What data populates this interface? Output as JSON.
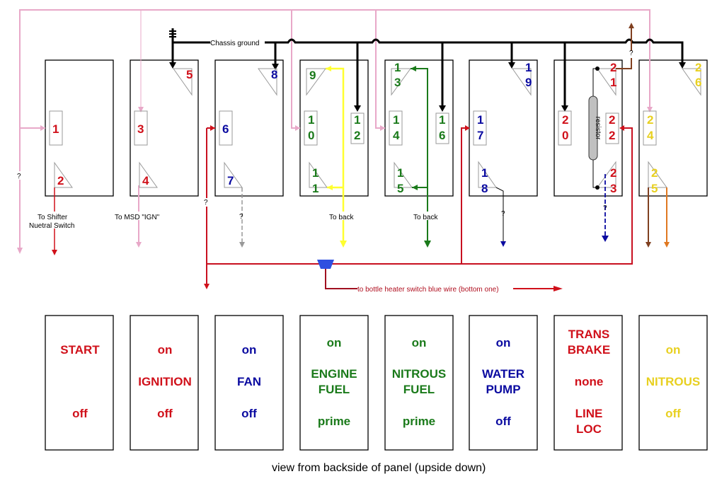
{
  "title": "view from backside of panel (upside down)",
  "colors": {
    "red": "#d0101a",
    "darkred": "#b01020",
    "blue": "#0a0aa0",
    "green": "#1a7a1a",
    "yellow": "#e8d020",
    "brightyellow": "#ffff30",
    "pink": "#e8a8c8",
    "black": "#000000",
    "gray": "#999999",
    "brown": "#804020",
    "orange": "#e07820",
    "bluebtn": "#3050e0",
    "resistor": "#c0c0c0"
  },
  "annotations": {
    "chassis_ground": "Chassis ground",
    "to_shifter_1": "To Shifter",
    "to_shifter_2": "Nuetral Switch",
    "to_msd": "To MSD \"IGN\"",
    "to_back_1": "To back",
    "to_back_2": "To back",
    "bottle_heater": "to bottle heater switch blue wire (bottom one)",
    "resistor": "resistor",
    "unknown": "?"
  },
  "switches": [
    {
      "id": "start",
      "pins": [
        {
          "n": "1",
          "type": "rect"
        },
        {
          "n": "2",
          "type": "tri-bl"
        }
      ],
      "color": "red",
      "label": {
        "top": "START",
        "mid": "",
        "bot": "off"
      }
    },
    {
      "id": "ignition",
      "pins": [
        {
          "n": "5",
          "type": "tri-tr"
        },
        {
          "n": "3",
          "type": "rect"
        },
        {
          "n": "4",
          "type": "tri-bl"
        }
      ],
      "color": "red",
      "label": {
        "top": "on",
        "mid": "IGNITION",
        "bot": "off"
      }
    },
    {
      "id": "fan",
      "pins": [
        {
          "n": "8",
          "type": "tri-tr"
        },
        {
          "n": "6",
          "type": "rect"
        },
        {
          "n": "7",
          "type": "tri-bl"
        }
      ],
      "color": "blue",
      "label": {
        "top": "on",
        "mid": "FAN",
        "bot": "off"
      }
    },
    {
      "id": "engine-fuel",
      "pins": [
        {
          "n": "9"
        },
        {
          "n": "10"
        },
        {
          "n": "12"
        },
        {
          "n": "11"
        }
      ],
      "color": "green",
      "label": {
        "top": "on",
        "mid1": "ENGINE",
        "mid2": "FUEL",
        "bot": "prime"
      }
    },
    {
      "id": "nitrous-fuel",
      "pins": [
        {
          "n": "13"
        },
        {
          "n": "14"
        },
        {
          "n": "16"
        },
        {
          "n": "15"
        }
      ],
      "color": "green",
      "label": {
        "top": "on",
        "mid1": "NITROUS",
        "mid2": "FUEL",
        "bot": "prime"
      }
    },
    {
      "id": "water-pump",
      "pins": [
        {
          "n": "19"
        },
        {
          "n": "17"
        },
        {
          "n": "18"
        }
      ],
      "color": "blue",
      "label": {
        "top": "on",
        "mid1": "WATER",
        "mid2": "PUMP",
        "bot": "off"
      }
    },
    {
      "id": "trans-brake",
      "pins": [
        {
          "n": "21"
        },
        {
          "n": "20"
        },
        {
          "n": "22"
        },
        {
          "n": "23"
        }
      ],
      "color": "red",
      "label": {
        "top1": "TRANS",
        "top2": "BRAKE",
        "mid": "none",
        "bot1": "LINE",
        "bot2": "LOC"
      }
    },
    {
      "id": "nitrous",
      "pins": [
        {
          "n": "26"
        },
        {
          "n": "24"
        },
        {
          "n": "25"
        }
      ],
      "color": "yellow",
      "label": {
        "top": "on",
        "mid": "NITROUS",
        "bot": "off"
      }
    }
  ]
}
